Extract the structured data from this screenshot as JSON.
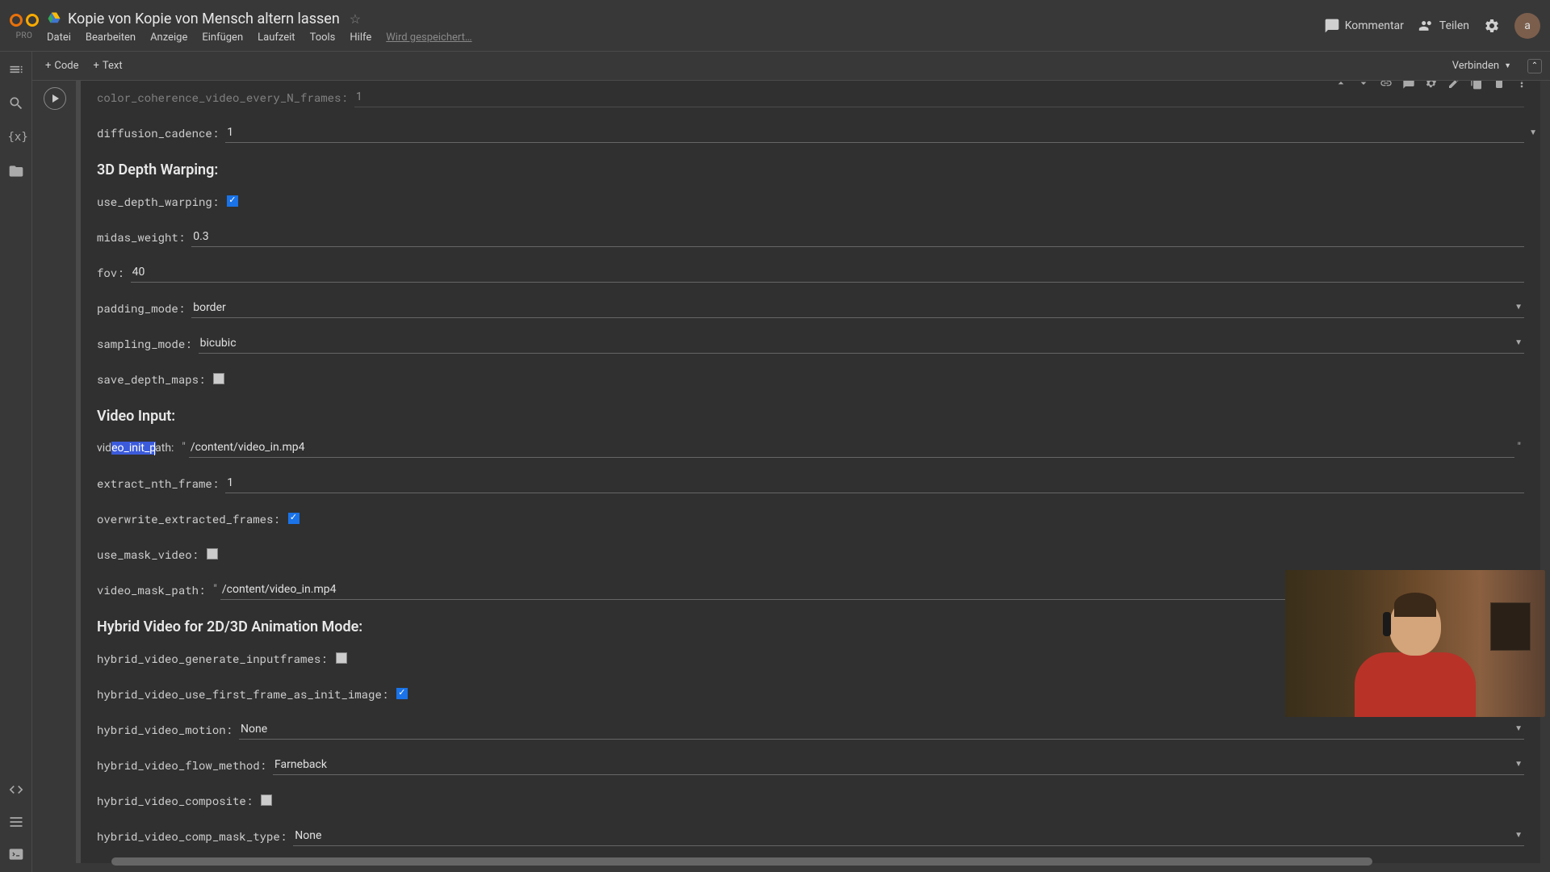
{
  "header": {
    "pro_label": "PRO",
    "title": "Kopie von Kopie von Mensch altern lassen",
    "menu": {
      "datei": "Datei",
      "bearbeiten": "Bearbeiten",
      "anzeige": "Anzeige",
      "einfugen": "Einfügen",
      "laufzeit": "Laufzeit",
      "tools": "Tools",
      "hilfe": "Hilfe",
      "saving": "Wird gespeichert…"
    },
    "kommentar": "Kommentar",
    "teilen": "Teilen",
    "avatar": "a"
  },
  "toolbar": {
    "code": "Code",
    "text": "Text",
    "connect": "Verbinden"
  },
  "form": {
    "color_coherence_label": "color_coherence_video_every_N_frames:",
    "color_coherence_value": "1",
    "diffusion_cadence_label": "diffusion_cadence:",
    "diffusion_cadence_value": "1",
    "section_3d": "3D Depth Warping:",
    "use_depth_warping_label": "use_depth_warping:",
    "midas_weight_label": "midas_weight:",
    "midas_weight_value": "0.3",
    "fov_label": "fov:",
    "fov_value": "40",
    "padding_mode_label": "padding_mode:",
    "padding_mode_value": "border",
    "sampling_mode_label": "sampling_mode:",
    "sampling_mode_value": "bicubic",
    "save_depth_maps_label": "save_depth_maps:",
    "section_video": "Video Input:",
    "video_init_path_label_pre": "vid",
    "video_init_path_label_sel": "eo_init_p",
    "video_init_path_label_post": "ath:",
    "video_init_path_value": "/content/video_in.mp4",
    "extract_nth_frame_label": "extract_nth_frame:",
    "extract_nth_frame_value": "1",
    "overwrite_extracted_frames_label": "overwrite_extracted_frames:",
    "use_mask_video_label": "use_mask_video:",
    "video_mask_path_label": "video_mask_path:",
    "video_mask_path_value": "/content/video_in.mp4",
    "section_hybrid": "Hybrid Video for 2D/3D Animation Mode:",
    "hybrid_generate_label": "hybrid_video_generate_inputframes:",
    "hybrid_first_frame_label": "hybrid_video_use_first_frame_as_init_image:",
    "hybrid_motion_label": "hybrid_video_motion:",
    "hybrid_motion_value": "None",
    "hybrid_flow_method_label": "hybrid_video_flow_method:",
    "hybrid_flow_method_value": "Farneback",
    "hybrid_composite_label": "hybrid_video_composite:",
    "hybrid_comp_mask_label": "hybrid_video_comp_mask_type:",
    "hybrid_comp_mask_value": "None"
  }
}
